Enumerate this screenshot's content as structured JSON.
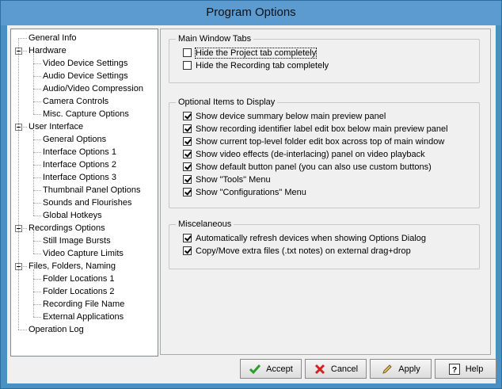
{
  "window": {
    "title": "Program Options"
  },
  "tree": {
    "items": [
      {
        "label": "General Info",
        "level": 0
      },
      {
        "label": "Hardware",
        "level": 0,
        "expanded": true
      },
      {
        "label": "Video Device Settings",
        "level": 1
      },
      {
        "label": "Audio Device Settings",
        "level": 1
      },
      {
        "label": "Audio/Video Compression",
        "level": 1
      },
      {
        "label": "Camera Controls",
        "level": 1
      },
      {
        "label": "Misc. Capture Options",
        "level": 1
      },
      {
        "label": "User Interface",
        "level": 0,
        "expanded": true
      },
      {
        "label": "General Options",
        "level": 1
      },
      {
        "label": "Interface Options 1",
        "level": 1
      },
      {
        "label": "Interface Options 2",
        "level": 1,
        "selected": true
      },
      {
        "label": "Interface Options 3",
        "level": 1
      },
      {
        "label": "Thumbnail Panel Options",
        "level": 1
      },
      {
        "label": "Sounds and Flourishes",
        "level": 1
      },
      {
        "label": "Global Hotkeys",
        "level": 1
      },
      {
        "label": "Recordings Options",
        "level": 0,
        "expanded": true
      },
      {
        "label": "Still Image Bursts",
        "level": 1
      },
      {
        "label": "Video Capture Limits",
        "level": 1
      },
      {
        "label": "Files, Folders, Naming",
        "level": 0,
        "expanded": true
      },
      {
        "label": "Folder Locations 1",
        "level": 1
      },
      {
        "label": "Folder Locations 2",
        "level": 1
      },
      {
        "label": "Recording File Name",
        "level": 1
      },
      {
        "label": "External Applications",
        "level": 1
      },
      {
        "label": "Operation Log",
        "level": 0
      }
    ]
  },
  "groups": {
    "main_tabs": {
      "title": "Main Window Tabs",
      "options": [
        {
          "label": "Hide the Project tab completely",
          "checked": false,
          "focused": true
        },
        {
          "label": "Hide the Recording tab completely",
          "checked": false
        }
      ]
    },
    "optional_items": {
      "title": "Optional Items to Display",
      "options": [
        {
          "label": "Show device summary below main preview panel",
          "checked": true
        },
        {
          "label": "Show recording identifier label edit box below main preview panel",
          "checked": true
        },
        {
          "label": "Show current top-level folder edit box across top of main window",
          "checked": true
        },
        {
          "label": "Show video effects (de-interlacing) panel on video playback",
          "checked": true
        },
        {
          "label": "Show default button panel (you can also use custom buttons)",
          "checked": true
        },
        {
          "label": "Show \"Tools\" Menu",
          "checked": true
        },
        {
          "label": "Show \"Configurations\" Menu",
          "checked": true
        }
      ]
    },
    "misc": {
      "title": "Miscelaneous",
      "options": [
        {
          "label": "Automatically refresh devices when showing Options Dialog",
          "checked": true
        },
        {
          "label": "Copy/Move extra files (.txt notes) on external drag+drop",
          "checked": true
        }
      ]
    }
  },
  "buttons": {
    "accept": "Accept",
    "cancel": "Cancel",
    "apply": "Apply",
    "help": "Help"
  }
}
